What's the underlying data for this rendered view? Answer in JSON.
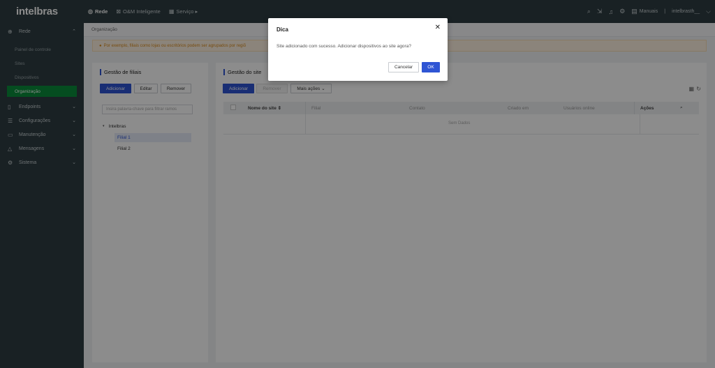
{
  "brand": {
    "logo_text": "intelbras"
  },
  "topnav": [
    {
      "icon": "globe-icon",
      "glyph": "◎",
      "label": "Rede",
      "active": true
    },
    {
      "icon": "om-icon",
      "glyph": "⊠",
      "label": "O&M Inteligente",
      "active": false
    },
    {
      "icon": "service-icon",
      "glyph": "▦",
      "label": "Serviço ▸",
      "active": false
    }
  ],
  "topright": {
    "manuals_label": "Manuais",
    "user_label": "intelbrasth__",
    "separator": "|"
  },
  "sidebar": {
    "rede": {
      "label": "Rede"
    },
    "sub_items": [
      {
        "label": "Painel de controle"
      },
      {
        "label": "Sites"
      },
      {
        "label": "Dispositivos"
      },
      {
        "label": "Organização"
      }
    ],
    "groups": [
      {
        "label": "Endpoints"
      },
      {
        "label": "Configurações"
      },
      {
        "label": "Manutenção"
      },
      {
        "label": "Mensagens"
      },
      {
        "label": "Sistema"
      }
    ]
  },
  "breadcrumb": {
    "label": "Organização"
  },
  "banner": {
    "text": "Por exemplo, filiais como lojas ou escritórios podem ser agrupados por regiõ"
  },
  "left_panel": {
    "title": "Gestão de filiais",
    "add_label": "Adicionar",
    "edit_label": "Editar",
    "remove_label": "Remover",
    "filter_placeholder": "Insira palavra-chave para filtrar ramos",
    "tree_root": "Intelbras",
    "tree_children": [
      "Filial 1",
      "Filial 2"
    ]
  },
  "right_panel": {
    "title": "Gestão do site",
    "add_label": "Adicionar",
    "remove_label": "Remover",
    "more_label": "Mais ações",
    "columns": [
      "Nome do site",
      "Filial",
      "Contato",
      "Criado em",
      "Usuários online",
      "Ações"
    ],
    "sort_glyph": "⇕",
    "empty_text": "Sem Dados"
  },
  "dialog": {
    "title": "Dica",
    "message": "Site adicionado com sucesso. Adicionar dispositivos ao site agora?",
    "cancel_label": "Cancelar",
    "ok_label": "OK",
    "close_glyph": "✕"
  },
  "colors": {
    "topbar": "#2e3d42",
    "primary": "#2f55d4",
    "active_sidebar": "#0a8d3b",
    "banner_text": "#d98a1c"
  }
}
